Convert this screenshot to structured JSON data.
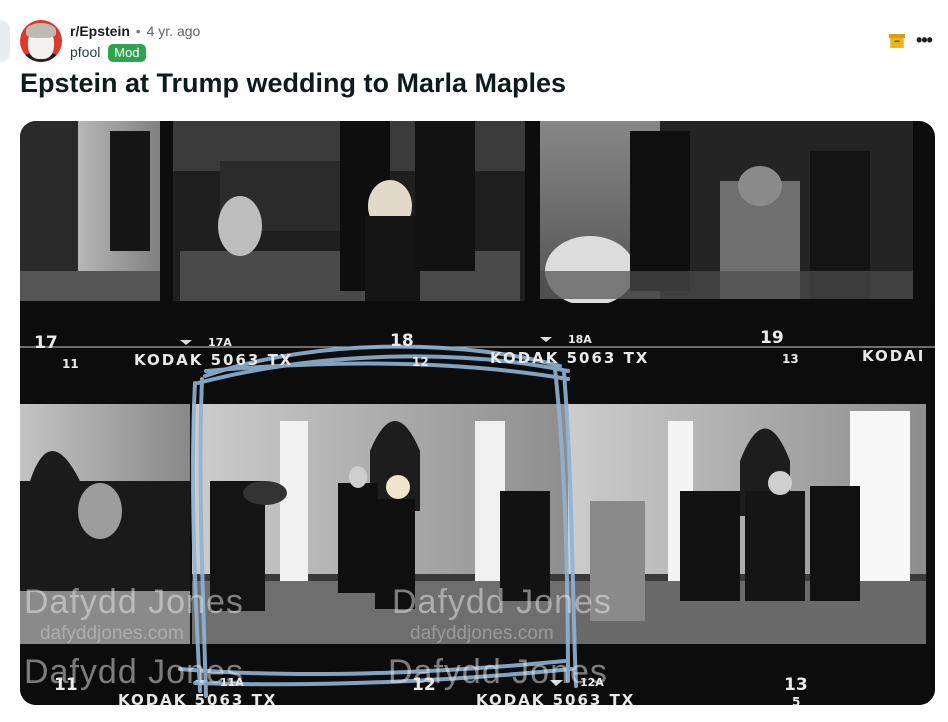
{
  "post": {
    "subreddit": "r/Epstein",
    "separator": "•",
    "age": "4 yr. ago",
    "username": "pfool",
    "badge": "Mod",
    "title": "Epstein at Trump wedding to Marla Maples"
  },
  "icons": {
    "avatar": "subreddit-avatar",
    "archive": "archive-icon",
    "more": "more-options-icon"
  },
  "colors": {
    "badge": "#2fa34f",
    "archive_icon": "#d4a10b",
    "highlight_scribble": "#8fb3d4"
  },
  "contact_sheet": {
    "top_frames": [
      "17",
      "18",
      "19"
    ],
    "top_edge_numbers": [
      "11",
      "12",
      "13"
    ],
    "top_arrow_labels": [
      "17A",
      "18A"
    ],
    "top_edge_text": [
      "KODAK 5063 TX",
      "KODAK 5063 TX",
      "KODAI"
    ],
    "bottom_frames": [
      "11",
      "12",
      "13"
    ],
    "bottom_arrow_labels": [
      "11A",
      "12A"
    ],
    "bottom_small": "5",
    "bottom_edge_text": [
      "KODAK 5063 TX",
      "KODAK 5063 TX"
    ],
    "watermark": "Dafydd Jones",
    "watermark_url": "dafyddjones.com"
  }
}
